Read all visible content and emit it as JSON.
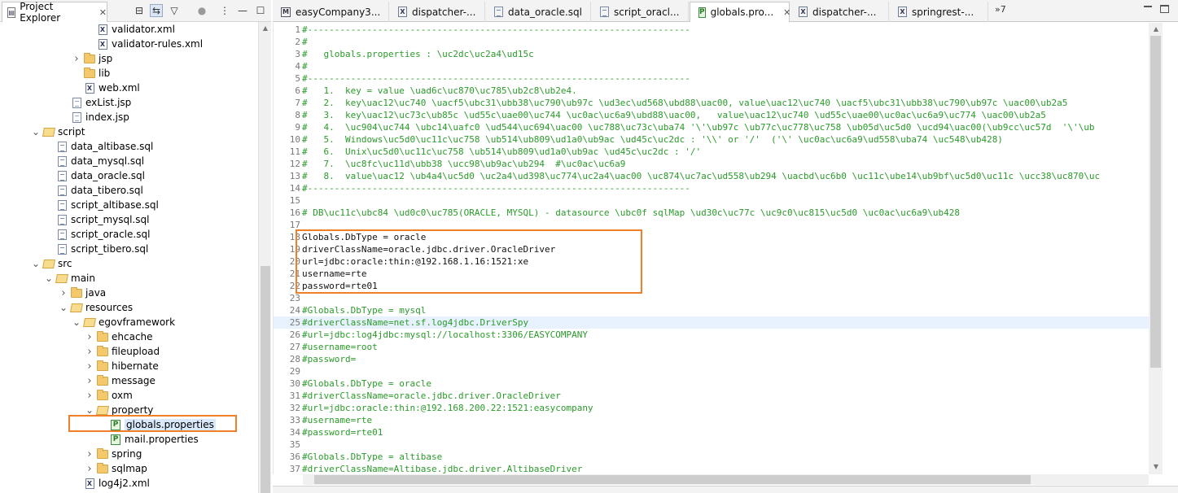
{
  "explorer": {
    "title": "Project Explorer",
    "tree": [
      {
        "label": "validator.xml",
        "icon": "xml-file-icon",
        "depth": 4
      },
      {
        "label": "validator-rules.xml",
        "icon": "xml-file-icon",
        "depth": 4
      },
      {
        "label": "jsp",
        "icon": "folder-icon",
        "depth": 3,
        "toggle": "collapsed"
      },
      {
        "label": "lib",
        "icon": "folder-icon",
        "depth": 3
      },
      {
        "label": "web.xml",
        "icon": "xml-file-icon",
        "depth": 3
      },
      {
        "label": "exList.jsp",
        "icon": "jsp-file-icon",
        "depth": 2
      },
      {
        "label": "index.jsp",
        "icon": "jsp-file-icon",
        "depth": 2
      },
      {
        "label": "script",
        "icon": "folder-open-icon",
        "depth": 0,
        "toggle": "expanded"
      },
      {
        "label": "data_altibase.sql",
        "icon": "sql-file-icon",
        "depth": 1
      },
      {
        "label": "data_mysql.sql",
        "icon": "sql-file-icon",
        "depth": 1
      },
      {
        "label": "data_oracle.sql",
        "icon": "sql-file-icon",
        "depth": 1
      },
      {
        "label": "data_tibero.sql",
        "icon": "sql-file-icon",
        "depth": 1
      },
      {
        "label": "script_altibase.sql",
        "icon": "sql-file-icon",
        "depth": 1
      },
      {
        "label": "script_mysql.sql",
        "icon": "sql-file-icon",
        "depth": 1
      },
      {
        "label": "script_oracle.sql",
        "icon": "sql-file-icon",
        "depth": 1
      },
      {
        "label": "script_tibero.sql",
        "icon": "sql-file-icon",
        "depth": 1
      },
      {
        "label": "src",
        "icon": "folder-open-icon",
        "depth": 0,
        "toggle": "expanded"
      },
      {
        "label": "main",
        "icon": "folder-open-icon",
        "depth": 1,
        "toggle": "expanded"
      },
      {
        "label": "java",
        "icon": "folder-icon",
        "depth": 2,
        "toggle": "collapsed"
      },
      {
        "label": "resources",
        "icon": "folder-open-icon",
        "depth": 2,
        "toggle": "expanded"
      },
      {
        "label": "egovframework",
        "icon": "folder-open-icon",
        "depth": 3,
        "toggle": "expanded"
      },
      {
        "label": "ehcache",
        "icon": "folder-icon",
        "depth": 4,
        "toggle": "collapsed"
      },
      {
        "label": "fileupload",
        "icon": "folder-icon",
        "depth": 4,
        "toggle": "collapsed"
      },
      {
        "label": "hibernate",
        "icon": "folder-icon",
        "depth": 4,
        "toggle": "collapsed"
      },
      {
        "label": "message",
        "icon": "folder-icon",
        "depth": 4,
        "toggle": "collapsed"
      },
      {
        "label": "oxm",
        "icon": "folder-icon",
        "depth": 4,
        "toggle": "collapsed"
      },
      {
        "label": "property",
        "icon": "folder-open-icon",
        "depth": 4,
        "toggle": "expanded"
      },
      {
        "label": "globals.properties",
        "icon": "properties-file-icon",
        "depth": 5,
        "selected": true
      },
      {
        "label": "mail.properties",
        "icon": "properties-file-icon",
        "depth": 5
      },
      {
        "label": "spring",
        "icon": "folder-icon",
        "depth": 4,
        "toggle": "collapsed"
      },
      {
        "label": "sqlmap",
        "icon": "folder-icon",
        "depth": 4,
        "toggle": "collapsed"
      },
      {
        "label": "log4j2.xml",
        "icon": "xml-file-icon",
        "depth": 3
      }
    ]
  },
  "editor": {
    "tabs": [
      {
        "label": "easyCompany3...",
        "icon": "m"
      },
      {
        "label": "dispatcher-...",
        "icon": "x"
      },
      {
        "label": "data_oracle.sql",
        "icon": "s"
      },
      {
        "label": "script_oracl...",
        "icon": "s"
      },
      {
        "label": "globals.pro...",
        "icon": "p",
        "active": true
      },
      {
        "label": "dispatcher-...",
        "icon": "x"
      },
      {
        "label": "springrest-...",
        "icon": "x"
      }
    ],
    "overflow_label": "»7",
    "lines": [
      {
        "n": "1",
        "text": "#-----------------------------------------------------------------------",
        "style": "comment"
      },
      {
        "n": "2",
        "text": "#",
        "style": "comment"
      },
      {
        "n": "3",
        "text": "#   globals.properties : \\uc2dc\\uc2a4\\ud15c",
        "style": "comment"
      },
      {
        "n": "4",
        "text": "#",
        "style": "comment"
      },
      {
        "n": "5",
        "text": "#-----------------------------------------------------------------------",
        "style": "comment"
      },
      {
        "n": "6",
        "text": "#   1.  key = value \\uad6c\\uc870\\uc785\\ub2c8\\ub2e4.",
        "style": "comment"
      },
      {
        "n": "7",
        "text": "#   2.  key\\uac12\\uc740 \\uacf5\\ubc31\\ubb38\\uc790\\ub97c \\ud3ec\\ud568\\ubd88\\uac00, value\\uac12\\uc740 \\uacf5\\ubc31\\ubb38\\uc790\\ub97c \\uac00\\ub2a5",
        "style": "comment"
      },
      {
        "n": "8",
        "text": "#   3.  key\\uac12\\uc73c\\ub85c \\ud55c\\uae00\\uc744 \\uc0ac\\uc6a9\\ubd88\\uac00,   value\\uac12\\uc740 \\ud55c\\uae00\\uc0ac\\uc6a9\\uc774 \\uac00\\ub2a5",
        "style": "comment"
      },
      {
        "n": "9",
        "text": "#   4.  \\uc904\\uc744 \\ubc14\\uafc0 \\ud544\\uc694\\uac00 \\uc788\\uc73c\\uba74 '\\'\\ub97c \\ub77c\\uc778\\uc758 \\ub05d\\uc5d0 \\ucd94\\uac00(\\ub9cc\\uc57d  '\\'\\ub",
        "style": "comment"
      },
      {
        "n": "10",
        "text": "#   5.  Windows\\uc5d0\\uc11c\\uc758 \\ub514\\ub809\\ud1a0\\ub9ac \\ud45c\\uc2dc : '\\\\' or '/'  ('\\' \\uc0ac\\uc6a9\\ud558\\uba74 \\uc548\\ub428)",
        "style": "comment"
      },
      {
        "n": "11",
        "text": "#   6.  Unix\\uc5d0\\uc11c\\uc758 \\ub514\\ub809\\ud1a0\\ub9ac \\ud45c\\uc2dc : '/'",
        "style": "comment"
      },
      {
        "n": "12",
        "text": "#   7.  \\uc8fc\\uc11d\\ubb38 \\ucc98\\ub9ac\\ub294  #\\uc0ac\\uc6a9",
        "style": "comment"
      },
      {
        "n": "13",
        "text": "#   8.  value\\uac12 \\ub4a4\\uc5d0 \\uc2a4\\ud398\\uc774\\uc2a4\\uac00 \\uc874\\uc7ac\\ud558\\ub294 \\uacbd\\uc6b0 \\uc11c\\ube14\\ub9bf\\uc5d0\\uc11c \\ucc38\\uc870\\uc",
        "style": "comment"
      },
      {
        "n": "14",
        "text": "#-----------------------------------------------------------------------",
        "style": "comment"
      },
      {
        "n": "15",
        "text": "",
        "style": "comment"
      },
      {
        "n": "16",
        "text": "# DB\\uc11c\\ubc84 \\ud0c0\\uc785(ORACLE, MYSQL) - datasource \\ubc0f sqlMap \\ud30c\\uc77c \\uc9c0\\uc815\\uc5d0 \\uc0ac\\uc6a9\\ub428",
        "style": "comment"
      },
      {
        "n": "17",
        "text": "",
        "style": "comment"
      },
      {
        "n": "18",
        "text": "Globals.DbType = oracle",
        "style": "kv"
      },
      {
        "n": "19",
        "text": "driverClassName=oracle.jdbc.driver.OracleDriver",
        "style": "kv"
      },
      {
        "n": "20",
        "text": "url=jdbc:oracle:thin:@192.168.1.16:1521:xe",
        "style": "kv"
      },
      {
        "n": "21",
        "text": "username=rte",
        "style": "kv"
      },
      {
        "n": "22",
        "text": "password=rte01",
        "style": "kv"
      },
      {
        "n": "23",
        "text": "",
        "style": "comment"
      },
      {
        "n": "24",
        "text": "#Globals.DbType = mysql",
        "style": "comment"
      },
      {
        "n": "25",
        "text": "#driverClassName=net.sf.log4jdbc.DriverSpy",
        "style": "comment",
        "current": true
      },
      {
        "n": "26",
        "text": "#url=jdbc:log4jdbc:mysql://localhost:3306/EASYCOMPANY",
        "style": "comment"
      },
      {
        "n": "27",
        "text": "#username=root",
        "style": "comment"
      },
      {
        "n": "28",
        "text": "#password=",
        "style": "comment"
      },
      {
        "n": "29",
        "text": "",
        "style": "comment"
      },
      {
        "n": "30",
        "text": "#Globals.DbType = oracle",
        "style": "comment"
      },
      {
        "n": "31",
        "text": "#driverClassName=oracle.jdbc.driver.OracleDriver",
        "style": "comment"
      },
      {
        "n": "32",
        "text": "#url=jdbc:oracle:thin:@192.168.200.22:1521:easycompany",
        "style": "comment"
      },
      {
        "n": "33",
        "text": "#username=rte",
        "style": "comment"
      },
      {
        "n": "34",
        "text": "#password=rte01",
        "style": "comment"
      },
      {
        "n": "35",
        "text": "",
        "style": "comment"
      },
      {
        "n": "36",
        "text": "#Globals.DbType = altibase",
        "style": "comment"
      },
      {
        "n": "37",
        "text": "#driverClassName=Altibase.jdbc.driver.AltibaseDriver",
        "style": "comment"
      }
    ]
  },
  "colors": {
    "comment": "#2a9b2a",
    "highlight_box": "#f07f2a",
    "selection": "#d9e8fb"
  }
}
